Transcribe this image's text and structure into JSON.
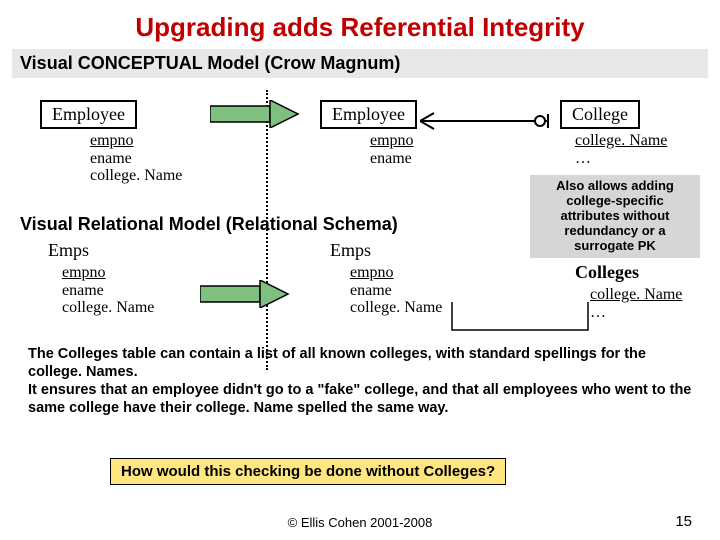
{
  "title": "Upgrading adds Referential Integrity",
  "section1": "Visual CONCEPTUAL Model (Crow Magnum)",
  "section2": "Visual Relational Model (Relational Schema)",
  "entities": {
    "emp1": "Employee",
    "emp2": "Employee",
    "college": "College"
  },
  "attrs": {
    "emp1": {
      "pk": "empno",
      "a1": "ename",
      "a2": "college. Name"
    },
    "emp2": {
      "pk": "empno",
      "a1": "ename"
    },
    "college": {
      "pk": "college. Name",
      "a1": "…"
    }
  },
  "relations": {
    "emps1": "Emps",
    "emps2": "Emps",
    "colleges": "Colleges"
  },
  "relattrs": {
    "emps1": {
      "pk": "empno",
      "a1": "ename",
      "a2": "college. Name"
    },
    "emps2": {
      "pk": "empno",
      "a1": "ename",
      "a2": "college. Name"
    },
    "colleges": {
      "pk": "college. Name",
      "a1": "…"
    }
  },
  "note": "Also allows adding college-specific attributes without redundancy or a surrogate PK",
  "explain": "The Colleges table can contain a list of all known colleges, with standard spellings for the college. Names.\nIt ensures that an employee didn't go to a \"fake\" college, and that all employees who went to the same college have their college. Name spelled the same way.",
  "question": "How would this checking be done without Colleges?",
  "copyright": "© Ellis Cohen 2001-2008",
  "pagenum": "15"
}
